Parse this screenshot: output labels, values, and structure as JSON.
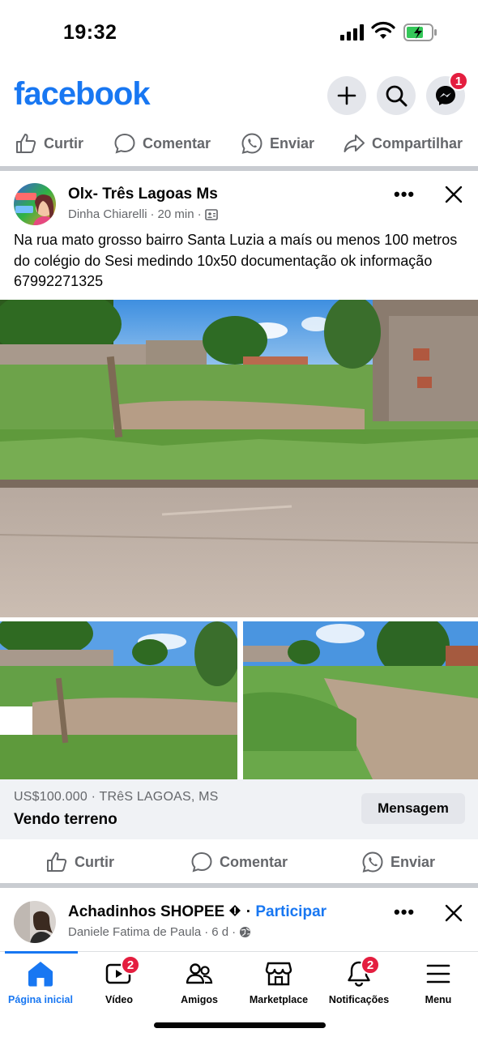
{
  "status": {
    "time": "19:32"
  },
  "header": {
    "logo": "facebook",
    "icons": [
      "plus-icon",
      "search-icon",
      "messenger-icon"
    ],
    "messenger_badge": "1"
  },
  "top_actions": {
    "like": "Curtir",
    "comment": "Comentar",
    "send": "Enviar",
    "share": "Compartilhar"
  },
  "post": {
    "group": "Olx- Três Lagoas Ms",
    "author": "Dinha Chiarelli",
    "time": "20 min",
    "separator": "·",
    "more": "•••",
    "text": "Na rua mato grosso bairro Santa Luzia  a maís ou menos 100 metros do colégio do Sesi medindo 10x50 documentação ok informação 67992271325",
    "avatar_overlay": "COMPRO / VENDO",
    "listing": {
      "price": "US$100.000 · TRêS LAGOAS, MS",
      "title": "Vendo terreno",
      "message_button": "Mensagem"
    },
    "actions": {
      "like": "Curtir",
      "comment": "Comentar",
      "send": "Enviar"
    }
  },
  "next_post": {
    "group": "Achadinhos SHOPEE",
    "join": "Participar",
    "author": "Daniele Fatima de Paula",
    "time": "6 d",
    "more": "•••"
  },
  "bottom_nav": [
    {
      "label": "Página inicial",
      "icon": "home-icon",
      "active": true
    },
    {
      "label": "Vídeo",
      "icon": "video-icon",
      "badge": "2"
    },
    {
      "label": "Amigos",
      "icon": "friends-icon"
    },
    {
      "label": "Marketplace",
      "icon": "marketplace-icon"
    },
    {
      "label": "Notificações",
      "icon": "bell-icon",
      "badge": "2"
    },
    {
      "label": "Menu",
      "icon": "menu-icon"
    }
  ],
  "colors": {
    "brand": "#1877f2",
    "badge": "#e41e3f",
    "secondary_text": "#65676b"
  }
}
